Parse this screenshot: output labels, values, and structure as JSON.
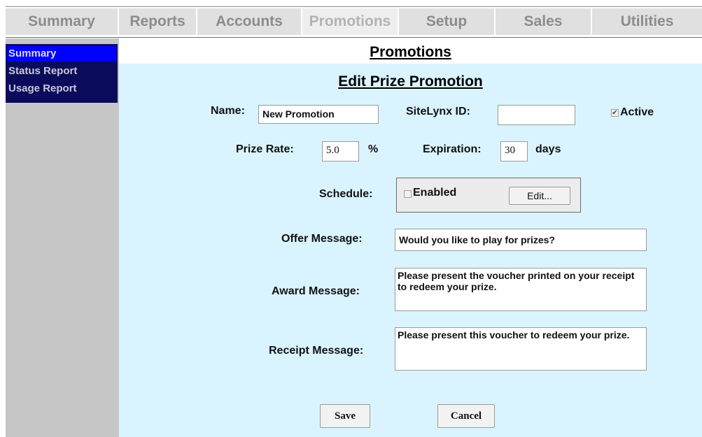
{
  "nav": {
    "tabs": [
      {
        "label": "Summary",
        "active": false
      },
      {
        "label": "Reports",
        "active": false
      },
      {
        "label": "Accounts",
        "active": false
      },
      {
        "label": "Promotions",
        "active": true
      },
      {
        "label": "Setup",
        "active": false
      },
      {
        "label": "Sales",
        "active": false
      },
      {
        "label": "Utilities",
        "active": false
      }
    ]
  },
  "sidebar": {
    "items": [
      {
        "label": "Summary",
        "selected": true
      },
      {
        "label": "Status Report",
        "selected": false
      },
      {
        "label": "Usage Report",
        "selected": false
      }
    ]
  },
  "main": {
    "title": "Promotions",
    "section_title": "Edit Prize Promotion"
  },
  "form": {
    "name_label": "Name:",
    "name_value": "New Promotion",
    "sitelynx_label": "SiteLynx ID:",
    "sitelynx_value": "",
    "active_label": "Active",
    "active_checked": true,
    "prize_rate_label": "Prize Rate:",
    "prize_rate_value": "5.0",
    "prize_rate_unit": "%",
    "expiration_label": "Expiration:",
    "expiration_value": "30",
    "expiration_unit": "days",
    "schedule_label": "Schedule:",
    "schedule_enabled_label": "Enabled",
    "schedule_enabled_checked": false,
    "schedule_edit_button": "Edit...",
    "offer_label": "Offer Message:",
    "offer_value": "Would you like to play for prizes?",
    "award_label": "Award Message:",
    "award_value": "Please present the voucher printed on your receipt to redeem your prize.",
    "receipt_label": "Receipt Message:",
    "receipt_value": "Please present this voucher to redeem your prize.",
    "save_button": "Save",
    "cancel_button": "Cancel"
  },
  "colors": {
    "sidebar_menu_bg": "#0b0b5c",
    "sidebar_selected_bg": "#0000ff",
    "main_bg": "#daf4ff",
    "sidebar_bg": "#c6c6c6"
  }
}
